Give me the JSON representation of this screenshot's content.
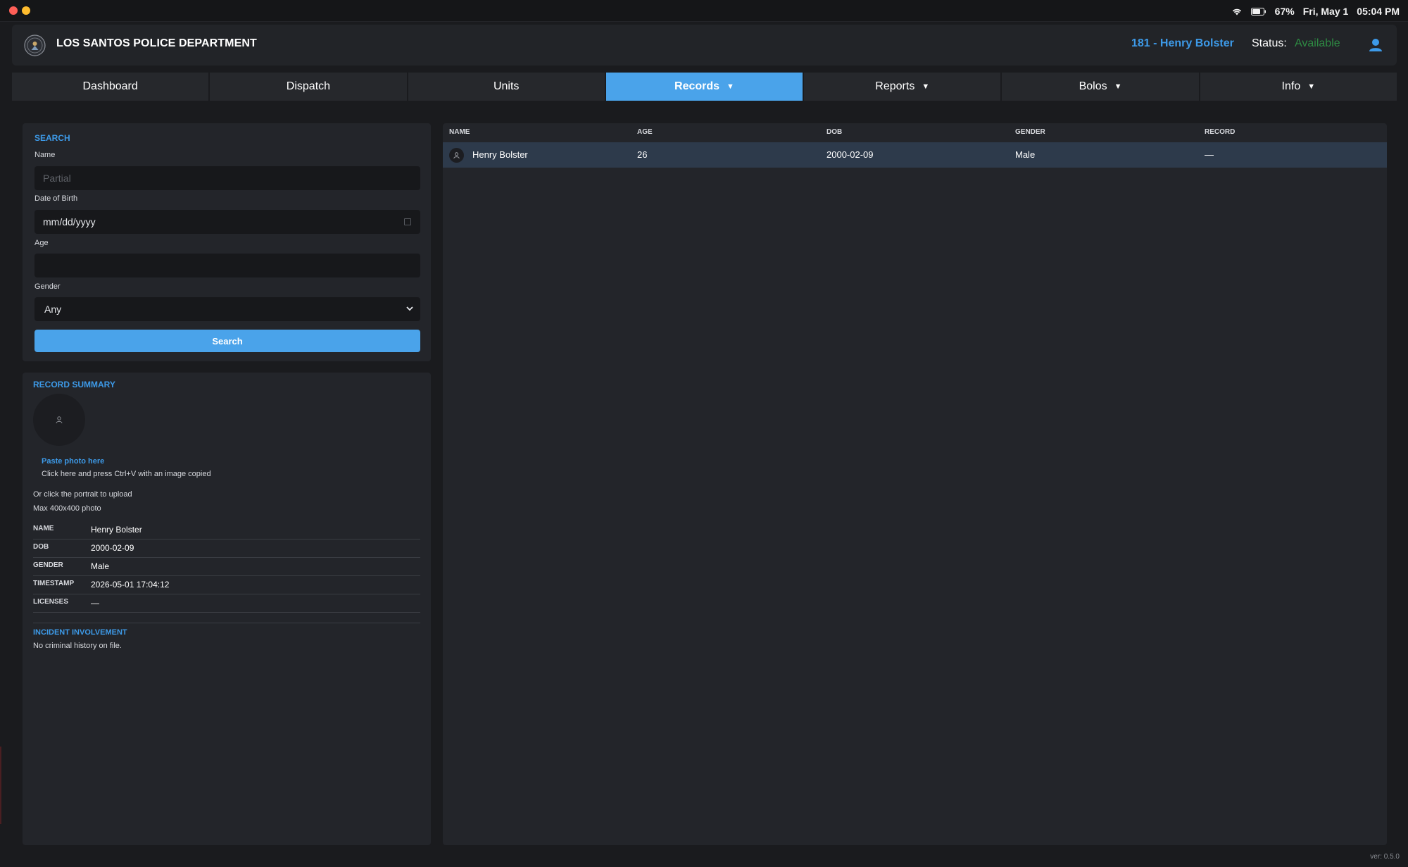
{
  "system": {
    "battery": "67%",
    "date": "Fri, May 1",
    "time": "05:04 PM"
  },
  "header": {
    "department": "LOS SANTOS POLICE DEPARTMENT",
    "officer": "181 - Henry Bolster",
    "status_label": "Status:",
    "status_value": "Available",
    "colors": {
      "accent": "#3d9ae8",
      "status_available": "#2e8b43"
    }
  },
  "nav": {
    "dashboard": "Dashboard",
    "dispatch": "Dispatch",
    "units": "Units",
    "records": "Records",
    "reports": "Reports",
    "bolos": "Bolos",
    "info": "Info",
    "caret": "▼",
    "active": "Records"
  },
  "search": {
    "title": "SEARCH",
    "name_label": "Name",
    "name_placeholder": "Partial",
    "name_value": "",
    "dob_label": "Date of Birth",
    "dob_value": "mm/dd/yyyy",
    "age_label": "Age",
    "age_value": "",
    "gender_label": "Gender",
    "gender_value": "Any",
    "button": "Search"
  },
  "summary": {
    "title": "RECORD SUMMARY",
    "paste_link": "Paste photo here",
    "paste_hint": "Click here and press Ctrl+V with an image copied",
    "upload_hint": "Or click the portrait to upload",
    "max_size": "Max 400x400 photo",
    "fields": [
      {
        "key": "NAME",
        "value": "Henry Bolster"
      },
      {
        "key": "DOB",
        "value": "2000-02-09"
      },
      {
        "key": "GENDER",
        "value": "Male"
      },
      {
        "key": "TIMESTAMP",
        "value": "2026-05-01 17:04:12"
      },
      {
        "key": "LICENSES",
        "value": "—"
      }
    ],
    "incident_title": "INCIDENT INVOLVEMENT",
    "incident_text": "No criminal history on file."
  },
  "results": {
    "columns": [
      "NAME",
      "AGE",
      "DOB",
      "GENDER",
      "RECORD"
    ],
    "rows": [
      {
        "name": "Henry Bolster",
        "age": "26",
        "dob": "2000-02-09",
        "gender": "Male",
        "record": "—"
      }
    ]
  },
  "footer": {
    "version": "ver: 0.5.0"
  }
}
